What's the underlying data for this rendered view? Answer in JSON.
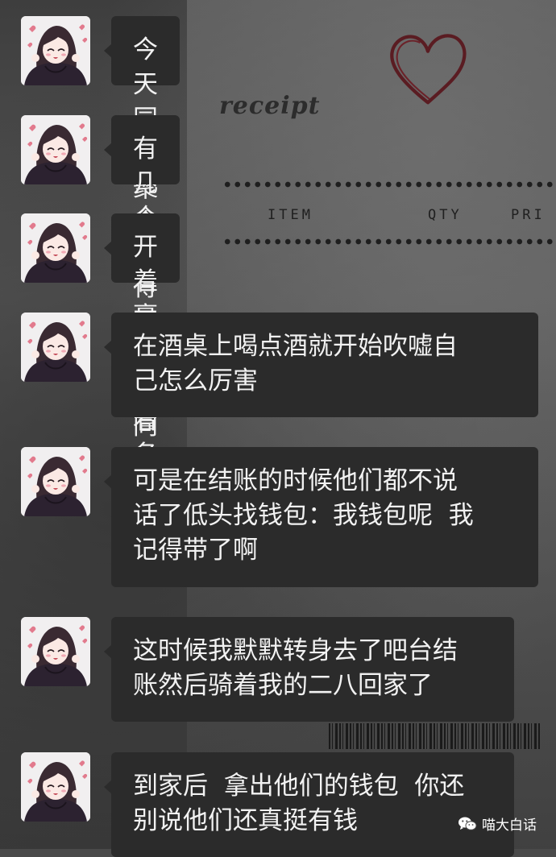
{
  "messages": [
    {
      "text": "今天同学聚会"
    },
    {
      "text": "有几个混得不错的同学"
    },
    {
      "text": "开着豪车  穿着名牌"
    },
    {
      "text": "在酒桌上喝点酒就开始吹嘘自\n己怎么厉害"
    },
    {
      "text": "可是在结账的时候他们都不说\n话了低头找钱包：我钱包呢  我\n记得带了啊"
    },
    {
      "text": "这时候我默默转身去了吧台结\n账然后骑着我的二八回家了"
    },
    {
      "text": "到家后  拿出他们的钱包  你还\n别说他们还真挺有钱"
    }
  ],
  "background": {
    "receipt_title": "receipt",
    "col_item": "ITEM",
    "col_qty": "QTY",
    "col_price": "PRI"
  },
  "watermark": {
    "icon": "wechat-icon",
    "text": "喵大白话"
  },
  "colors": {
    "bubble": "#2b2b2b",
    "bubble_text": "#f2f2f2",
    "avatar_bg": "#f1eff0"
  }
}
